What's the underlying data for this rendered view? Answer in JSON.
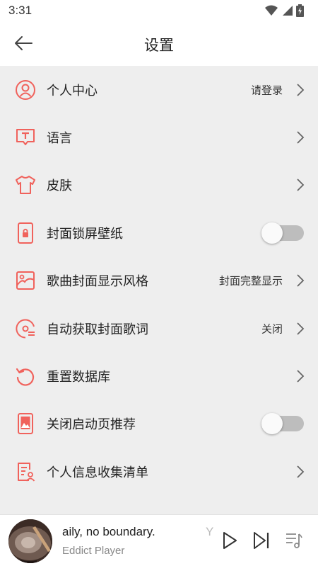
{
  "status_bar": {
    "time": "3:31",
    "icons": [
      "wifi-icon",
      "signal-icon",
      "battery-charging-icon"
    ]
  },
  "app_bar": {
    "back_icon": "arrow-left-icon",
    "title": "设置"
  },
  "theme": {
    "accent": "#f0625c",
    "list_background": "#eeeeee",
    "toggle_track_off": "#bdbdbd"
  },
  "settings": {
    "items": [
      {
        "label": "个人中心",
        "value": "请登录",
        "icon": "user-circle-icon",
        "control": "chevron"
      },
      {
        "label": "语言",
        "value": "",
        "icon": "language-icon",
        "control": "chevron"
      },
      {
        "label": "皮肤",
        "value": "",
        "icon": "tshirt-icon",
        "control": "chevron"
      },
      {
        "label": "封面锁屏壁纸",
        "value": "",
        "icon": "lock-screen-icon",
        "control": "toggle",
        "toggle_on": false
      },
      {
        "label": "歌曲封面显示风格",
        "value": "封面完整显示",
        "icon": "cover-style-icon",
        "control": "chevron"
      },
      {
        "label": "自动获取封面歌词",
        "value": "关闭",
        "icon": "disc-lyrics-icon",
        "control": "chevron"
      },
      {
        "label": "重置数据库",
        "value": "",
        "icon": "reset-icon",
        "control": "chevron"
      },
      {
        "label": "关闭启动页推荐",
        "value": "",
        "icon": "splash-image-icon",
        "control": "toggle",
        "toggle_on": false
      },
      {
        "label": "个人信息收集清单",
        "value": "",
        "icon": "document-user-icon",
        "control": "chevron"
      }
    ]
  },
  "player": {
    "track_title": "aily, no boundary.",
    "artist": "Eddict Player",
    "marquee_next": "Y",
    "icons": [
      "play-icon",
      "skip-next-icon",
      "playlist-icon"
    ]
  }
}
